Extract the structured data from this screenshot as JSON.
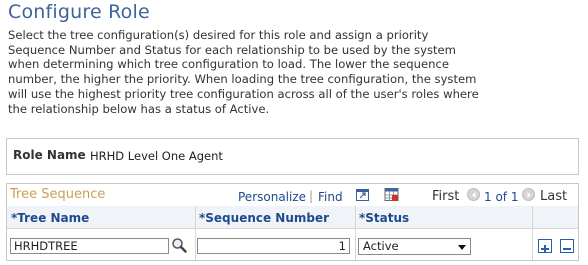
{
  "page": {
    "title": "Configure Role",
    "description_lines": [
      "Select the tree configuration(s) desired for this role and assign a priority",
      "Sequence Number and Status for each relationship to be used by the system",
      "when determining which tree configuration to load. The lower the sequence",
      "number, the higher the priority. When loading the tree configuration, the system",
      "will use the highest priority tree configuration across all of the user's roles where",
      "the relationship below has a status of Active."
    ]
  },
  "role": {
    "label": "Role Name",
    "value": "HRHD Level One Agent"
  },
  "grid": {
    "title": "Tree Sequence",
    "personalize_label": "Personalize",
    "separator": "|",
    "find_label": "Find",
    "first_label": "First",
    "page_indicator": "1 of 1",
    "last_label": "Last",
    "columns": [
      "*Tree Name",
      "*Sequence Number",
      "*Status"
    ],
    "rows": [
      {
        "tree_name": "HRHDTREE",
        "sequence_number": "1",
        "status": "Active"
      }
    ]
  },
  "icons": {
    "view_all": "view-all-icon",
    "download": "download-to-excel-icon",
    "prev": "previous-arrow-icon",
    "next": "next-arrow-icon",
    "lookup": "lookup-magnifier-icon",
    "add": "add-row-icon",
    "delete": "delete-row-icon"
  },
  "colors": {
    "title": "#3d6599",
    "grid_title": "#c8a055",
    "link": "#1e4a8c",
    "header_bg": "#f0f4f8"
  }
}
